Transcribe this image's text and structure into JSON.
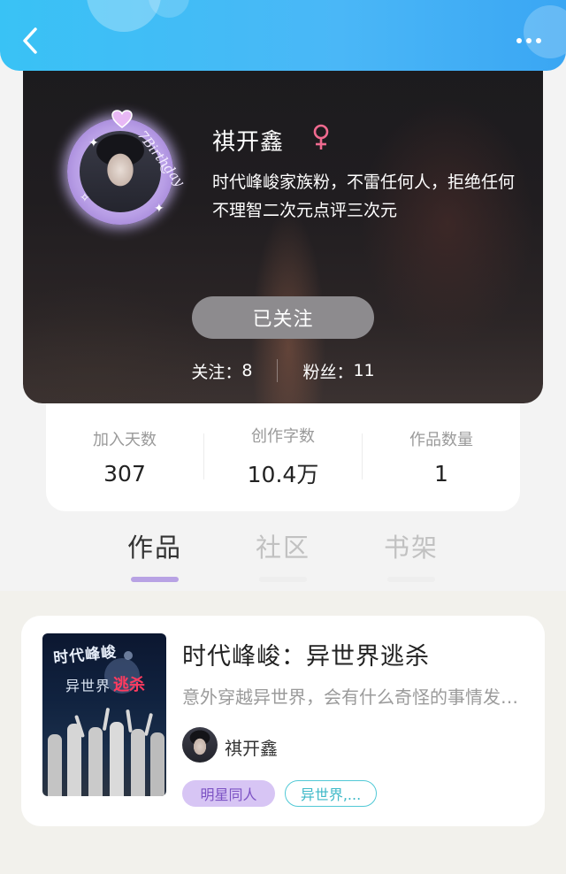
{
  "header": {
    "back_icon": "chevron-left-icon",
    "more_icon": "more-dots-icon",
    "bar_color": "#3ab8f5"
  },
  "profile": {
    "name": "祺开鑫",
    "gender_symbol": "♀",
    "gender_color": "#f06a8f",
    "avatar_frame_text": "7Birthday",
    "bio": "时代峰峻家族粉，不雷任何人，拒绝任何不理智二次元点评三次元",
    "follow_button": "已关注",
    "following_label": "关注：",
    "following_count": "8",
    "fans_label": "粉丝：",
    "fans_count": "11"
  },
  "stats": [
    {
      "label": "加入天数",
      "value": "307"
    },
    {
      "label": "创作字数",
      "value": "10.4万"
    },
    {
      "label": "作品数量",
      "value": "1"
    }
  ],
  "tabs": [
    {
      "label": "作品",
      "active": true
    },
    {
      "label": "社区",
      "active": false
    },
    {
      "label": "书架",
      "active": false
    }
  ],
  "works": [
    {
      "cover_text_1": "时代峰峻",
      "cover_text_2": "异世界",
      "cover_text_3": "逃杀",
      "title": "时代峰峻：异世界逃杀",
      "description": "意外穿越异世界，会有什么奇怪的事情发生呢",
      "author": "祺开鑫",
      "tags": [
        "明星同人",
        "异世界,..."
      ]
    }
  ],
  "colors": {
    "tab_indicator": "#b8a2e4",
    "tag_purple_bg": "#d7c5f4",
    "tag_outline": "#51c9d6"
  }
}
